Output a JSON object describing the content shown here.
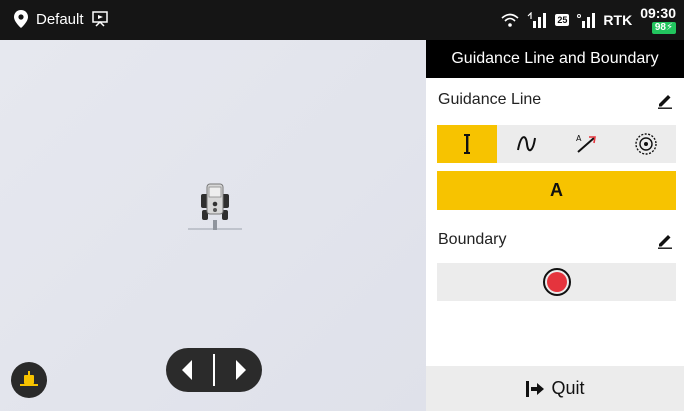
{
  "statusbar": {
    "profile_name": "Default",
    "sim_label": "25",
    "rtk_label": "RTK",
    "clock": "09:30",
    "battery": "98"
  },
  "panel": {
    "title": "Guidance Line and Boundary",
    "guidance_section": "Guidance Line",
    "modes": [
      "straight-line",
      "curve",
      "a-plus",
      "pivot"
    ],
    "active_mode": "straight-line",
    "a_point_label": "A",
    "boundary_section": "Boundary",
    "quit_label": "Quit"
  },
  "colors": {
    "accent": "#f7c300",
    "record": "#e5343d",
    "header_bg": "#000000"
  }
}
